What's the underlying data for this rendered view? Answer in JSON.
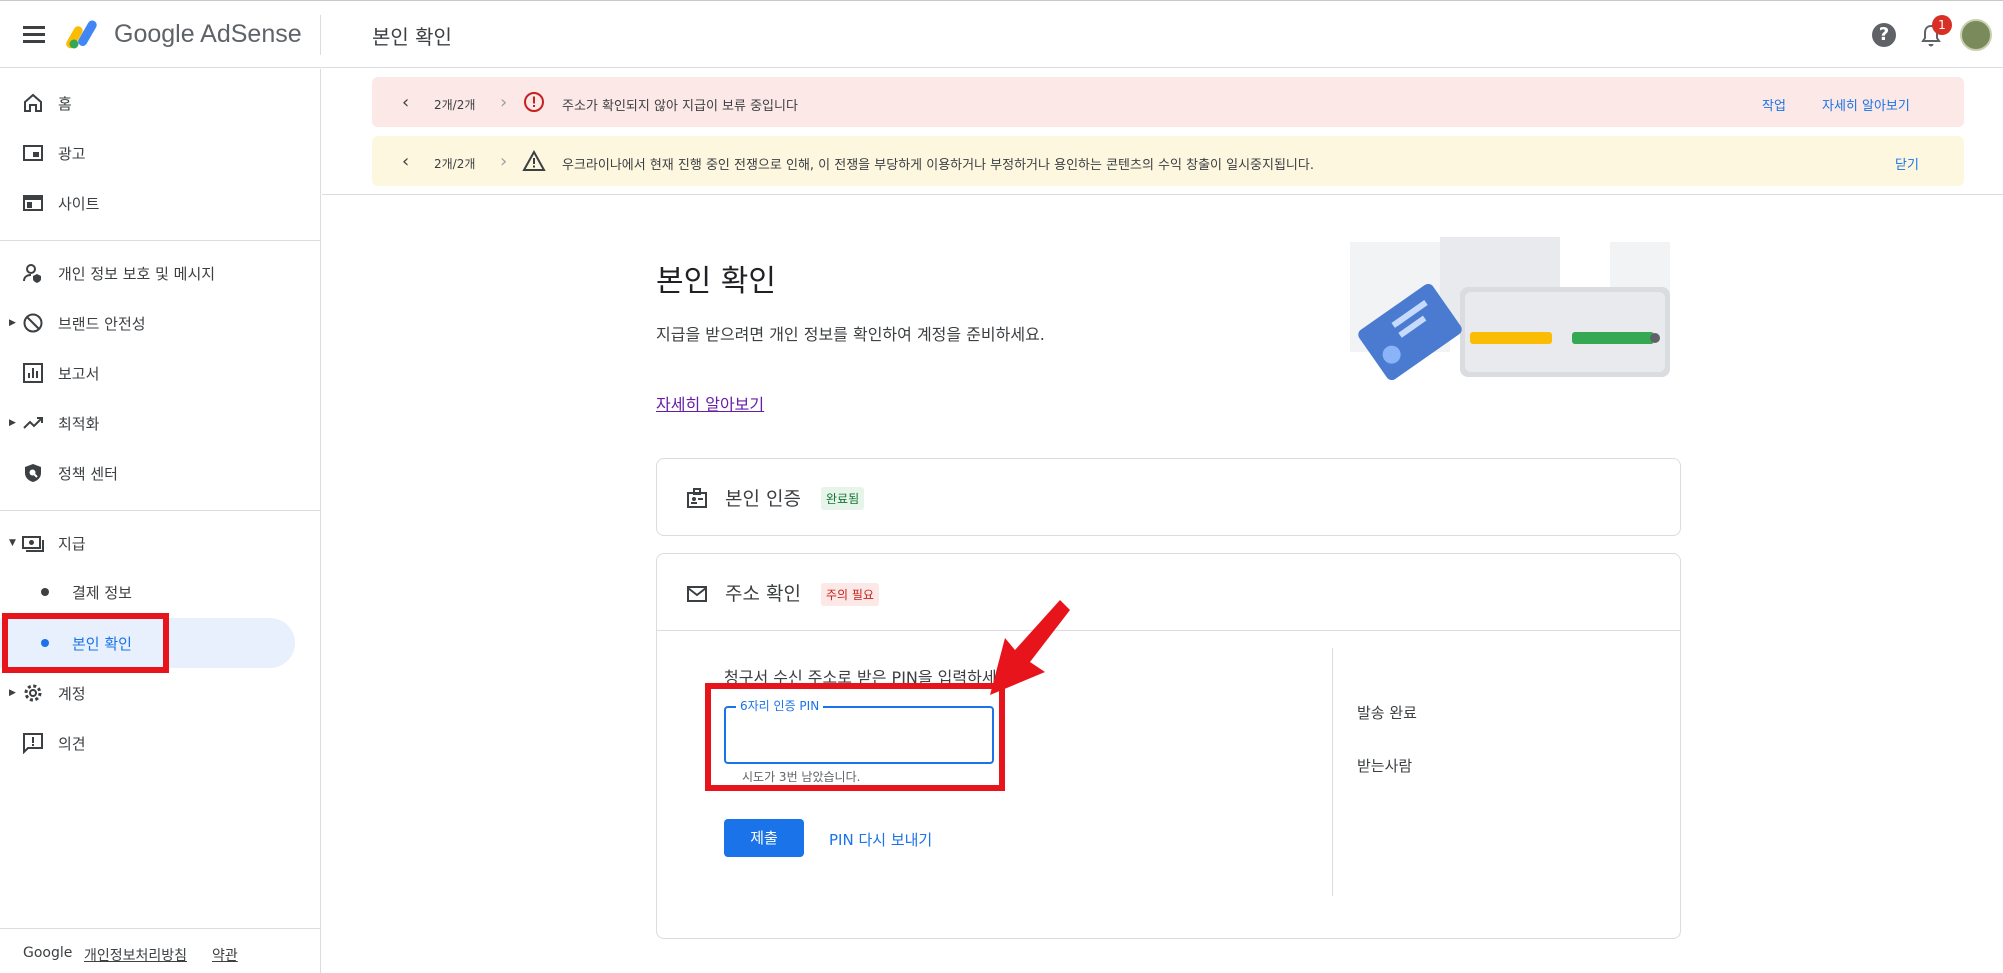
{
  "topbar": {
    "brand": "Google AdSense",
    "page_title": "본인 확인",
    "notification_count": "1"
  },
  "sidebar": {
    "items": [
      {
        "label": "홈",
        "icon": "home-icon"
      },
      {
        "label": "광고",
        "icon": "ads-icon"
      },
      {
        "label": "사이트",
        "icon": "sites-icon"
      },
      {
        "label": "개인 정보 보호 및 메시지",
        "icon": "privacy-icon"
      },
      {
        "label": "브랜드 안전성",
        "icon": "block-icon"
      },
      {
        "label": "보고서",
        "icon": "reports-icon"
      },
      {
        "label": "최적화",
        "icon": "trending-icon"
      },
      {
        "label": "정책 센터",
        "icon": "policy-shield-icon"
      },
      {
        "label": "지급",
        "icon": "payments-icon"
      },
      {
        "label": "계정",
        "icon": "settings-gear-icon"
      },
      {
        "label": "의견",
        "icon": "feedback-icon"
      }
    ],
    "payments_sub": [
      {
        "label": "결제 정보"
      },
      {
        "label": "본인 확인"
      }
    ],
    "footer": {
      "google": "Google",
      "privacy": "개인정보처리방침",
      "terms": "약관"
    }
  },
  "banners": [
    {
      "count": "2개/2개",
      "message": "주소가 확인되지 않아 지급이 보류 중입니다",
      "action1": "작업",
      "action2": "자세히 알아보기",
      "color": "#fce8e6",
      "icon": "error-circle-icon"
    },
    {
      "count": "2개/2개",
      "message": "우크라이나에서 현재 진행 중인 전쟁으로 인해, 이 전쟁을 부당하게 이용하거나 부정하거나 용인하는 콘텐츠의 수익 창출이 일시중지됩니다.",
      "action1": "닫기",
      "color": "#fef7e0",
      "icon": "warning-triangle-icon"
    }
  ],
  "main": {
    "title": "본인 확인",
    "description": "지급을 받으려면 개인 정보를 확인하여 계정을 준비하세요.",
    "learn_more": "자세히 알아보기",
    "identity_card": {
      "title": "본인 인증",
      "status": "완료됨"
    },
    "address_card": {
      "title": "주소 확인",
      "status": "주의 필요",
      "prompt": "청구서 수신 주소로 받은 PIN을 입력하세요.",
      "pin_label": "6자리 인증 PIN",
      "pin_value": "",
      "attempts_hint": "시도가 3번 남았습니다.",
      "submit": "제출",
      "resend": "PIN 다시 보내기",
      "side_status_1": "발송 완료",
      "side_status_2": "받는사람"
    }
  },
  "colors": {
    "accent": "#1a73e8",
    "annotation_red": "#e8141c"
  }
}
